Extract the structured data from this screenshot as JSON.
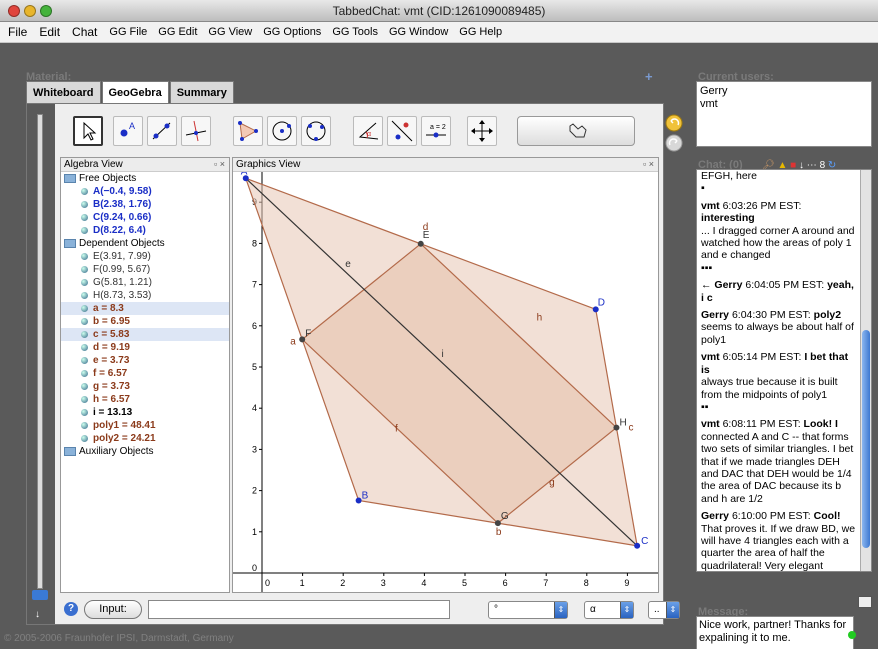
{
  "window": {
    "title": "TabbedChat: vmt (CID:1261090089485)"
  },
  "menu": [
    "File",
    "Edit",
    "Chat",
    "GG File",
    "GG Edit",
    "GG View",
    "GG Options",
    "GG Tools",
    "GG Window",
    "GG Help"
  ],
  "material": {
    "header": "Material:",
    "tabs": [
      "Whiteboard",
      "GeoGebra",
      "Summary"
    ],
    "plus": "+"
  },
  "algebra": {
    "title": "Algebra View",
    "free_label": "Free Objects",
    "free": [
      "A(−0.4, 9.58)",
      "B(2.38, 1.76)",
      "C(9.24, 0.66)",
      "D(8.22, 6.4)"
    ],
    "dependent_label": "Dependent Objects",
    "dependent": [
      "E(3.91, 7.99)",
      "F(0.99, 5.67)",
      "G(5.81, 1.21)",
      "H(8.73, 3.53)",
      "a = 8.3",
      "b = 6.95",
      "c = 5.83",
      "d = 9.19",
      "e = 3.73",
      "f = 6.57",
      "g = 3.73",
      "h = 6.57",
      "i = 13.13",
      "poly1 = 48.41",
      "poly2 = 24.21"
    ],
    "aux_label": "Auxiliary Objects"
  },
  "graphics": {
    "title": "Graphics View",
    "x_ticks": [
      "0",
      "1",
      "2",
      "3",
      "4",
      "5",
      "6",
      "7",
      "8",
      "9"
    ],
    "y_ticks": [
      "1",
      "2",
      "3",
      "4",
      "5",
      "6",
      "7",
      "8",
      "9"
    ],
    "origin": "0",
    "points": [
      {
        "name": "A",
        "x": -0.4,
        "y": 9.58
      },
      {
        "name": "B",
        "x": 2.38,
        "y": 1.76
      },
      {
        "name": "C",
        "x": 9.24,
        "y": 0.66
      },
      {
        "name": "D",
        "x": 8.22,
        "y": 6.4
      },
      {
        "name": "E",
        "x": 3.91,
        "y": 7.99
      },
      {
        "name": "F",
        "x": 0.99,
        "y": 5.67
      },
      {
        "name": "G",
        "x": 5.81,
        "y": 1.21
      },
      {
        "name": "H",
        "x": 8.73,
        "y": 3.53
      }
    ],
    "segment_labels": [
      "a",
      "b",
      "c",
      "d",
      "e",
      "f",
      "g",
      "h",
      "i"
    ]
  },
  "input_bar": {
    "help": "?",
    "label": "Input:",
    "value": "",
    "combo1": "°",
    "combo2": "α",
    "combo3": ".."
  },
  "users": {
    "header": "Current users:",
    "list": [
      "Gerry",
      "vmt"
    ]
  },
  "chat": {
    "header": "Chat: (0)",
    "messages": [
      {
        "who": "",
        "text": "EFGH, here",
        "tail": "▪"
      },
      {
        "who": "vmt",
        "time": "6:03:26 PM EST:",
        "lead": "interesting",
        "text": "... I dragged corner A around and watched how the areas of poly 1 and e changed",
        "tail": "▪▪▪"
      },
      {
        "who": "Gerry",
        "time": "6:04:05 PM EST:",
        "lead": "yeah, i c",
        "text": "",
        "tail": "",
        "arrow": "←"
      },
      {
        "who": "Gerry",
        "time": "6:04:30 PM EST:",
        "lead": "poly2",
        "text": "seems to always be about half of poly1",
        "tail": ""
      },
      {
        "who": "vmt",
        "time": "6:05:14 PM EST:",
        "lead": "I bet that is",
        "text": "always true because it is built from the midpoints of poly1",
        "tail": "▪▪"
      },
      {
        "who": "vmt",
        "time": "6:08:11 PM EST:",
        "lead": "Look! I",
        "text": "connected A and C -- that forms two sets of similar triangles. I bet that if we made triangles DEH and DAC that DEH would be 1/4 the area of DAC because its b and h are 1/2",
        "tail": ""
      },
      {
        "who": "Gerry",
        "time": "6:10:00 PM EST:",
        "lead": "Cool!",
        "text": "That proves it. If we draw BD, we will have 4 triangles each with a quarter the area of half the quadrilateral! Very elegant",
        "tail": "▪▪▪"
      }
    ]
  },
  "message": {
    "header": "Message:",
    "value": "Nice work, partner! Thanks for expalining it to me."
  },
  "footer": "© 2005-2006 Fraunhofer IPSI, Darmstadt, Germany",
  "colors": {
    "point_free": "#1a2ec6",
    "poly_fill": "#e8c7b4",
    "poly_stroke": "#b36a4a"
  }
}
